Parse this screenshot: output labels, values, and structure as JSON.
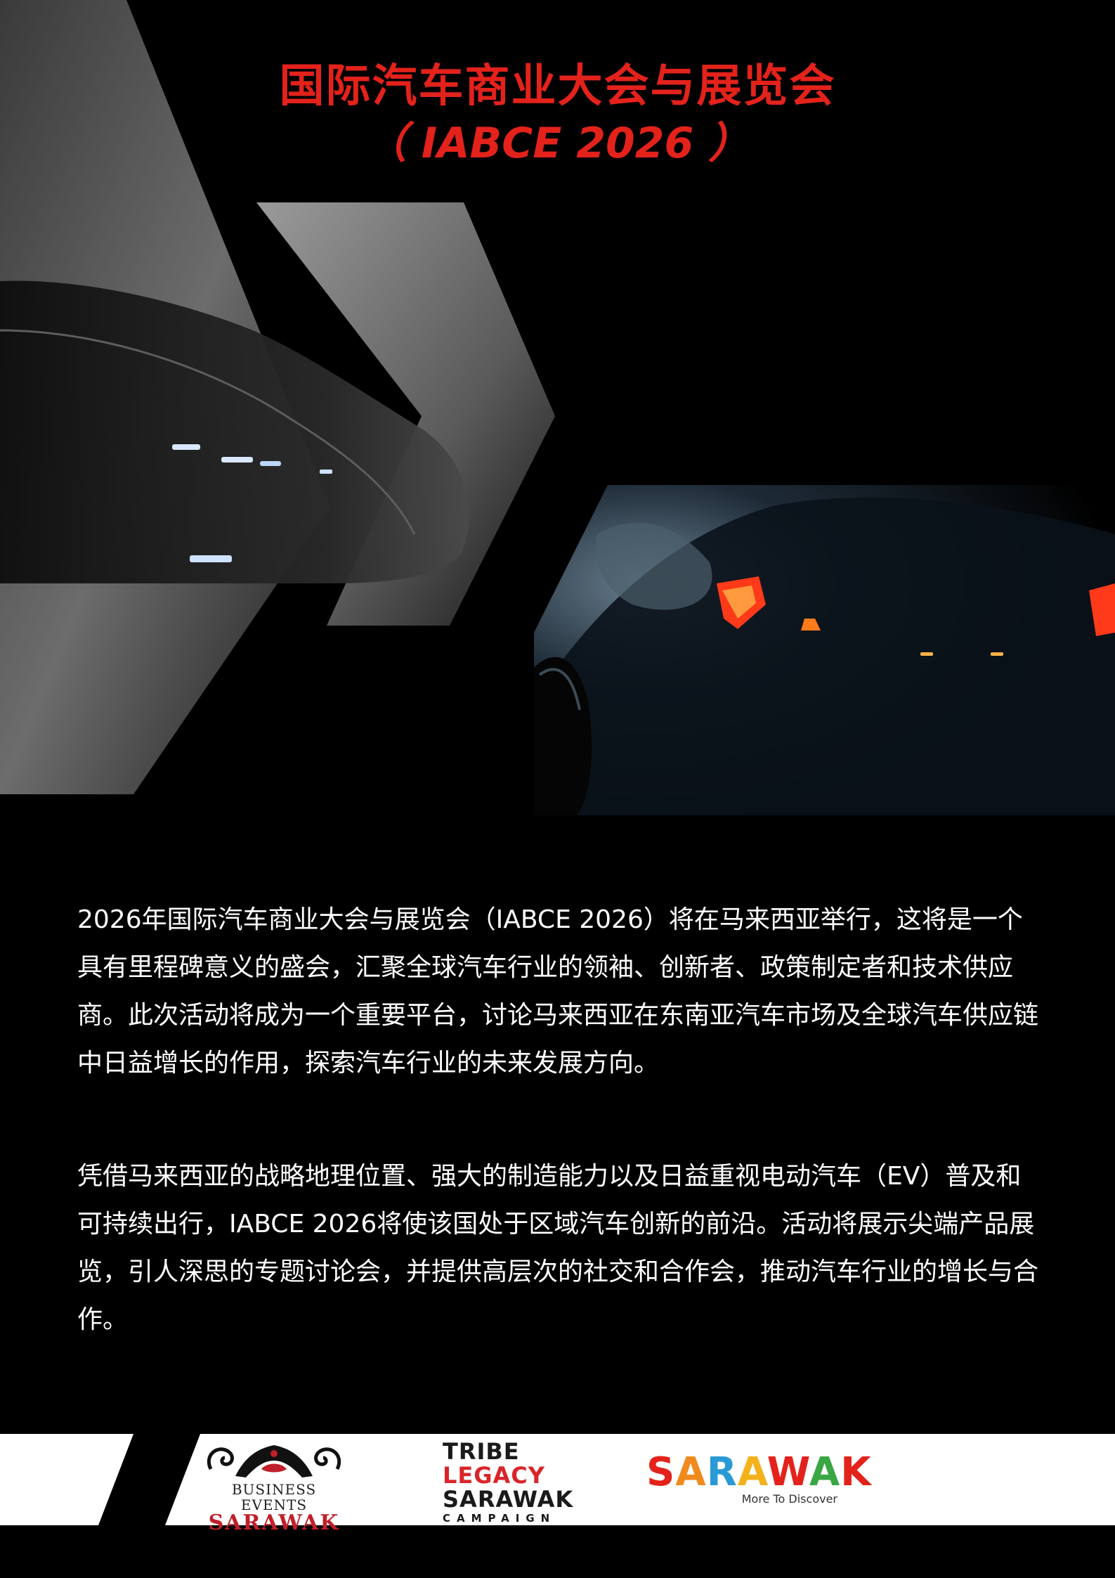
{
  "title": {
    "line1": "国际汽车商业大会与展览会",
    "line2": "（ IABCE 2026 ）"
  },
  "body": {
    "para1": "2026年国际汽车商业大会与展览会（IABCE 2026）将在马来西亚举行，这将是一个具有里程碑意义的盛会，汇聚全球汽车行业的领袖、创新者、政策制定者和技术供应商。此次活动将成为一个重要平台，讨论马来西亚在东南亚汽车市场及全球汽车供应链中日益增长的作用，探索汽车行业的未来发展方向。",
    "para2": "凭借马来西亚的战略地理位置、强大的制造能力以及日益重视电动汽车（EV）普及和可持续出行，IABCE 2026将使该国处于区域汽车创新的前沿。活动将展示尖端产品展览，引人深思的专题讨论会，并提供高层次的社交和合作会，推动汽车行业的增长与合作。"
  },
  "logos": {
    "bes": {
      "top": "BUSINESS EVENTS",
      "bottom": "SARAWAK"
    },
    "tribe": {
      "l1": "TRIBE",
      "l2": "LEGACY",
      "l3": "SARAWAK",
      "l4": "CAMPAIGN"
    },
    "sarawak": {
      "letters": [
        "S",
        "A",
        "R",
        "A",
        "W",
        "A",
        "K"
      ],
      "letter_colors": [
        "#e3231b",
        "#f08a1d",
        "#2a9ad6",
        "#f3b21c",
        "#e3231b",
        "#3aa745",
        "#e3231b"
      ],
      "tagline": "More To Discover"
    }
  },
  "colors": {
    "accent": "#e3221b",
    "background": "#000000"
  }
}
